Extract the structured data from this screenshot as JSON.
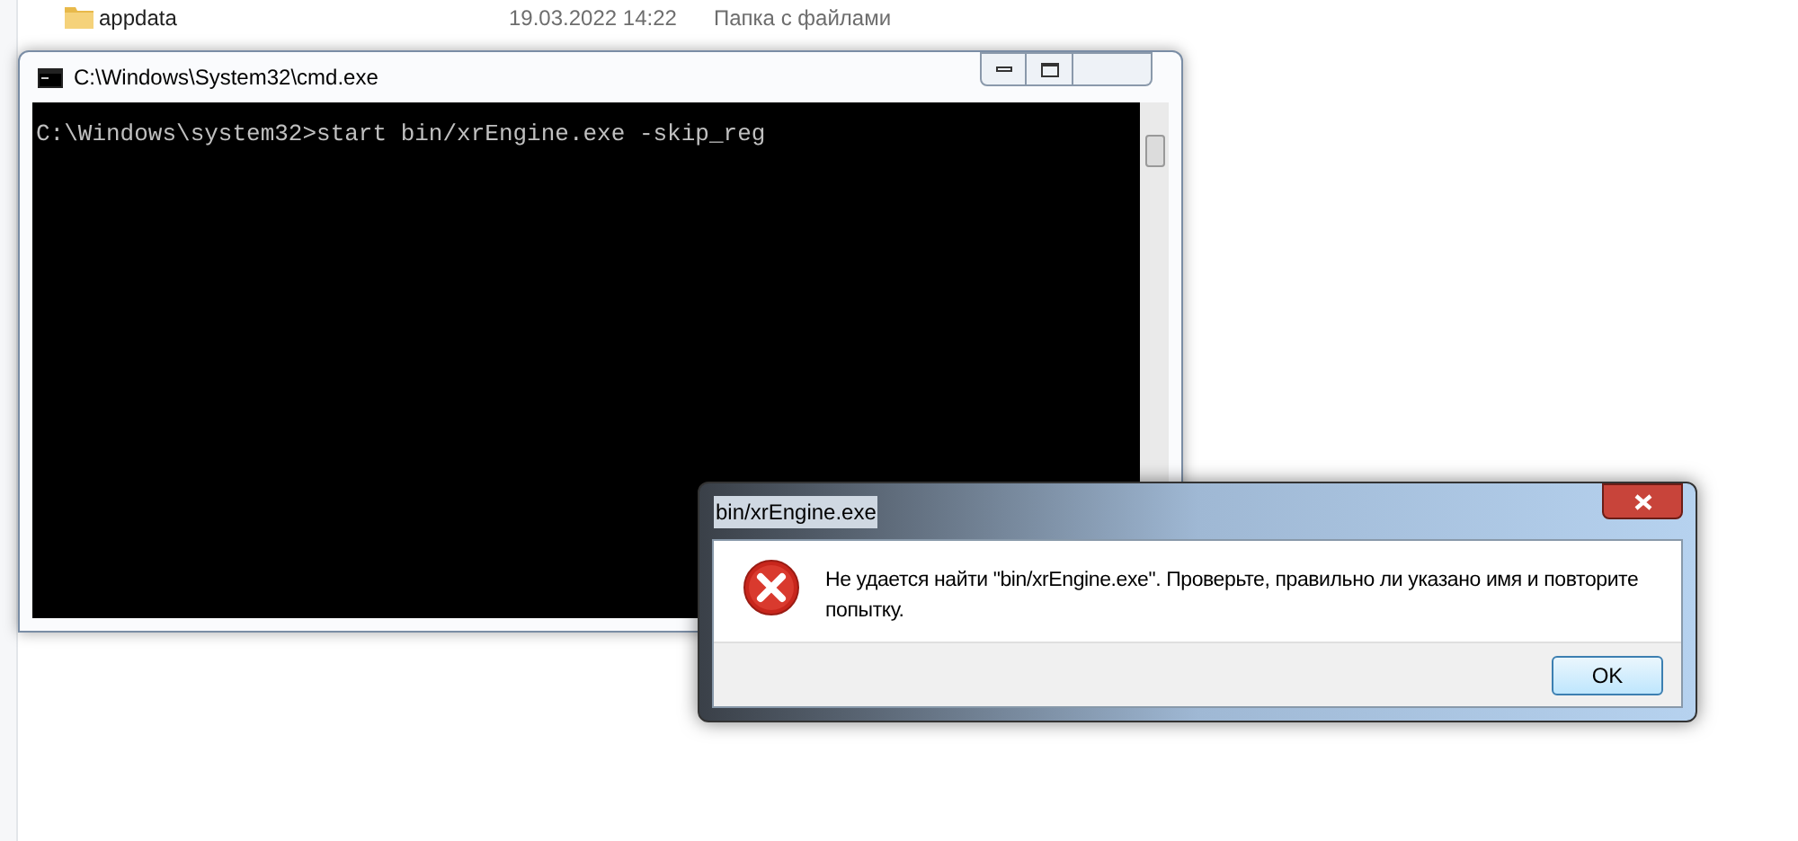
{
  "explorer": {
    "rows": [
      {
        "name": "appdata",
        "date": "19.03.2022 14:22",
        "type": "Папка с файлами"
      }
    ]
  },
  "console_window": {
    "title": "C:\\Windows\\System32\\cmd.exe",
    "lines": [
      "C:\\Windows\\system32>start bin/xrEngine.exe -skip_reg"
    ]
  },
  "error_dialog": {
    "title": "bin/xrEngine.exe",
    "message": "Не удается найти \"bin/xrEngine.exe\". Проверьте, правильно ли указано имя и повторите попытку.",
    "buttons": [
      "OK"
    ]
  }
}
